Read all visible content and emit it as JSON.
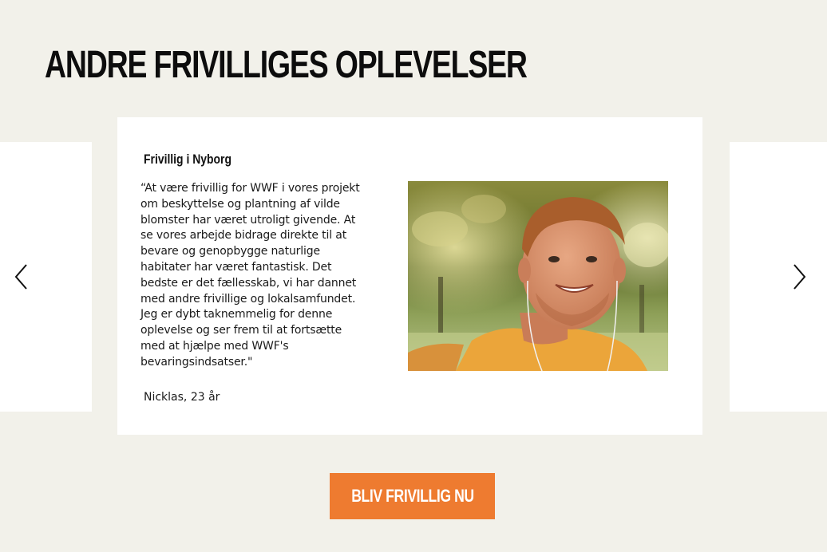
{
  "page": {
    "title": "ANDRE FRIVILLIGES OPLEVELSER"
  },
  "carousel": {
    "prev_icon": "chevron-left-icon",
    "next_icon": "chevron-right-icon",
    "active_slide": {
      "heading": "Frivillig i Nyborg",
      "quote": "“At være frivillig for WWF i vores projekt om beskyttelse og plantning af vilde blomster har været utroligt givende. At se vores arbejde bidrage direkte til at bevare og genopbygge naturlige habitater har været fantastisk. Det bedste er det fællesskab, vi har dannet med andre frivillige og lokalsamfundet. Jeg er dybt taknemmelig for denne oplevelse og ser frem til at fortsætte med at hjælpe med WWF's bevaringsindsatser.\"",
      "author": "Nicklas, 23 år"
    }
  },
  "cta": {
    "label": "BLIV FRIVILLIG NU"
  },
  "colors": {
    "background": "#f2f1ea",
    "card": "#ffffff",
    "accent": "#ee7b30",
    "text": "#1a1a1a"
  }
}
